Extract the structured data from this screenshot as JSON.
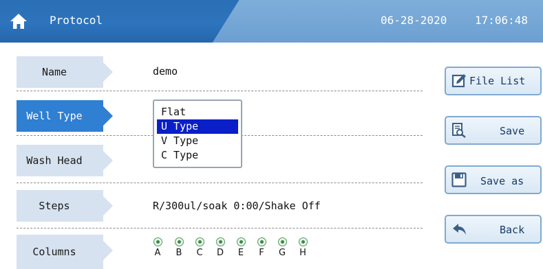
{
  "header": {
    "title": "Protocol",
    "date": "06-28-2020",
    "time": "17:06:48",
    "home_icon": "home-icon",
    "color": "#2d74bc"
  },
  "rows": {
    "name": {
      "label": "Name",
      "value": "demo"
    },
    "well_type": {
      "label": "Well Type",
      "options": [
        "Flat",
        "U Type",
        "V Type",
        "C Type"
      ],
      "selected": "U Type"
    },
    "wash_head": {
      "label": "Wash Head"
    },
    "steps": {
      "label": "Steps",
      "value": "R/300ul/soak 0:00/Shake Off"
    },
    "columns": {
      "label": "Columns",
      "letters": [
        "A",
        "B",
        "C",
        "D",
        "E",
        "F",
        "G",
        "H"
      ]
    }
  },
  "buttons": {
    "file_list": "File List",
    "save": "Save",
    "save_as": "Save as",
    "back": "Back"
  },
  "colors": {
    "active_label": "#2f7fd3",
    "inactive_label": "#d6e2ef",
    "selection": "#0a1fc8"
  }
}
